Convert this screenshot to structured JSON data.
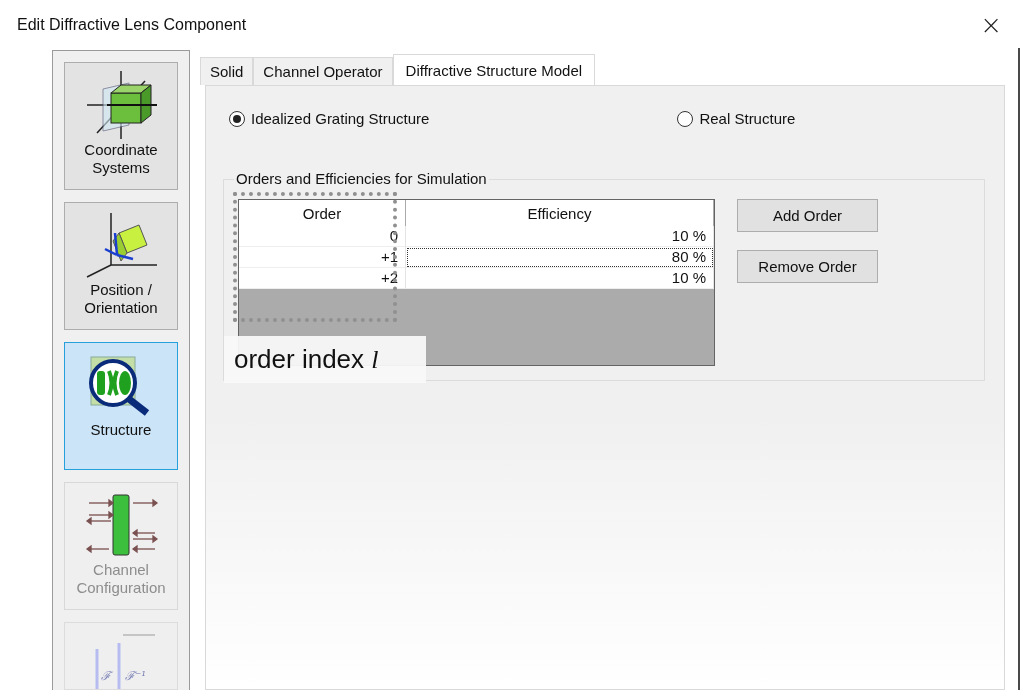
{
  "window": {
    "title": "Edit Diffractive Lens Component",
    "close": "×"
  },
  "sidebar": {
    "items": [
      {
        "kind": "coordinates",
        "label": "Coordinate Systems",
        "selected": false,
        "disabled": false
      },
      {
        "kind": "position",
        "label": "Position / Orientation",
        "selected": false,
        "disabled": false
      },
      {
        "kind": "structure",
        "label": "Structure",
        "selected": true,
        "disabled": false
      },
      {
        "kind": "channels",
        "label": "Channel Configuration",
        "selected": false,
        "disabled": true
      },
      {
        "kind": "fourier",
        "glyphs": [
          "ℱ",
          "ℱ⁻¹"
        ],
        "selected": false,
        "disabled": true
      }
    ]
  },
  "tabs": [
    {
      "label": "Solid",
      "selected": false
    },
    {
      "label": "Channel Operator",
      "selected": false
    },
    {
      "label": "Diffractive Structure Model",
      "selected": true
    }
  ],
  "radios": [
    {
      "label": "Idealized Grating Structure",
      "selected": true
    },
    {
      "label": "Real Structure",
      "selected": false
    }
  ],
  "group": {
    "title": "Orders and Efficiencies for Simulation",
    "table": {
      "columns": [
        "Order",
        "Efficiency"
      ],
      "rows": [
        {
          "order": "0",
          "efficiency": "10 %",
          "focused": false
        },
        {
          "order": "+1",
          "efficiency": "80 %",
          "focused": true
        },
        {
          "order": "+2",
          "efficiency": "10 %",
          "focused": false
        }
      ]
    },
    "buttons": [
      "Add Order",
      "Remove Order"
    ]
  },
  "annotation": {
    "label": "order index *l*"
  }
}
